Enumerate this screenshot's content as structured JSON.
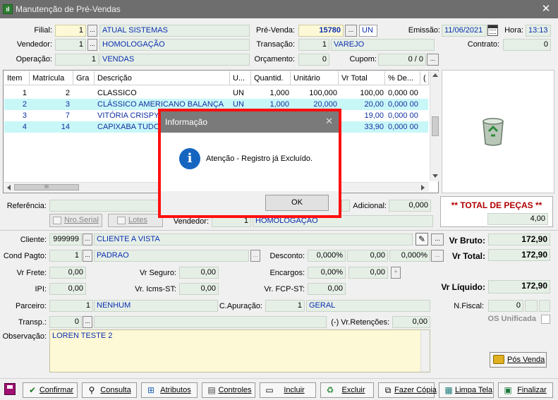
{
  "window": {
    "title": "Manutenção de Pré-Vendas",
    "close": "✕"
  },
  "header": {
    "filial_label": "Filial:",
    "filial_code": "1",
    "filial_name": "ATUAL SISTEMAS",
    "vendedor_label": "Vendedor:",
    "vendedor_code": "1",
    "vendedor_name": "HOMOLOGAÇÃO",
    "operacao_label": "Operação:",
    "operacao_code": "1",
    "operacao_name": "VENDAS",
    "prevenda_label": "Pré-Venda:",
    "prevenda_value": "15780",
    "prevenda_unit": "UN",
    "transacao_label": "Transação:",
    "transacao_code": "1",
    "transacao_name": "VAREJO",
    "orcamento_label": "Orçamento:",
    "orcamento_value": "0",
    "cupom_label": "Cupom:",
    "cupom_value": "0 / 0",
    "emissao_label": "Emissão:",
    "emissao_value": "11/06/2021",
    "hora_label": "Hora:",
    "hora_value": "13:13",
    "contrato_label": "Contrato:",
    "contrato_value": "0",
    "ellipsis": "..."
  },
  "grid": {
    "columns": [
      "Item",
      "Matrícula",
      "Gra",
      "Descrição",
      "U...",
      "Quantid.",
      "Unitário",
      "Vr Total",
      "% De...",
      "("
    ],
    "rows": [
      {
        "item": "1",
        "matricula": "2",
        "gra": "",
        "descricao": "CLASSICO",
        "un": "UN",
        "quantid": "1,000",
        "unitario": "100,000",
        "vrtotal": "100,00",
        "desc": "0,000 00"
      },
      {
        "item": "2",
        "matricula": "3",
        "gra": "",
        "descricao": "CLÁSSICO AMERICANO BALANÇA",
        "un": "UN",
        "quantid": "1,000",
        "unitario": "20,000",
        "vrtotal": "20,00",
        "desc": "0,000 00"
      },
      {
        "item": "3",
        "matricula": "7",
        "gra": "",
        "descricao": "VITÓRIA CRISPY",
        "un": "",
        "quantid": "",
        "unitario": "",
        "vrtotal": "19,00",
        "desc": "0,000 00"
      },
      {
        "item": "4",
        "matricula": "14",
        "gra": "",
        "descricao": "CAPIXABA TUDO",
        "un": "",
        "quantid": "",
        "unitario": "",
        "vrtotal": "33,90",
        "desc": "0,000 00"
      }
    ],
    "hscroll_grip": "III"
  },
  "midbar": {
    "referencia_label": "Referência:",
    "adicional_label": "Adicional:",
    "adicional_value": "0,000",
    "nro_serial": "Nro.Serial",
    "lotes": "Lotes",
    "vendedor_label": "Vendedor:",
    "vendedor_code": "1",
    "vendedor_name": "HOMOLOGAÇÃO"
  },
  "totals": {
    "pecas_label": "** TOTAL DE PEÇAS **",
    "pecas_value": "4,00"
  },
  "footer": {
    "cliente_label": "Cliente:",
    "cliente_code": "999999",
    "cliente_name": "CLIENTE A VISTA",
    "condpagto_label": "Cond Pagto:",
    "condpagto_code": "1",
    "condpagto_name": "PADRAO",
    "desconto_label": "Desconto:",
    "desconto_pct": "0,000%",
    "desconto_val": "0,00",
    "desconto_pct2": "0,000%",
    "vrfrete_label": "Vr Frete:",
    "vrfrete_value": "0,00",
    "vrseguro_label": "Vr Seguro:",
    "vrseguro_value": "0,00",
    "encargos_label": "Encargos:",
    "encargos_pct": "0,00%",
    "encargos_val": "0,00",
    "plus": "+",
    "ipi_label": "IPI:",
    "ipi_value": "0,00",
    "icmsst_label": "Vr. Icms-ST:",
    "icmsst_value": "0,00",
    "fcpst_label": "Vr. FCP-ST:",
    "fcpst_value": "0,00",
    "parceiro_label": "Parceiro:",
    "parceiro_code": "1",
    "parceiro_name": "NENHUM",
    "capuracao_label": "C.Apuração:",
    "capuracao_code": "1",
    "capuracao_name": "GERAL",
    "transp_label": "Transp.:",
    "transp_code": "0",
    "retencoes_label": "(-) Vr.Retenções:",
    "retencoes_value": "0,00",
    "observacao_label": "Observação:",
    "observacao_value": "LOREN TESTE 2",
    "vrbruto_label": "Vr Bruto:",
    "vrbruto_value": "172,90",
    "vrtotal_label": "Vr Total:",
    "vrtotal_value": "172,90",
    "vrliquido_label": "Vr Líquido:",
    "vrliquido_value": "172,90",
    "nfiscal_label": "N.Fiscal:",
    "nfiscal_value": "0",
    "osunificada_label": "OS Unificada",
    "posvenda": "Pós Venda"
  },
  "toolbar": {
    "confirmar": "Confirmar",
    "consulta": "Consulta",
    "atributos": "Atributos",
    "controles": "Controles",
    "incluir": "Incluir",
    "excluir": "Excluir",
    "fazercopia": "Fazer Cópia",
    "limpatela": "Limpa Tela",
    "finalizar": "Finalizar"
  },
  "dialog": {
    "title": "Informação",
    "close": "✕",
    "message": "Atenção - Registro já Excluído.",
    "ok": "OK",
    "icon": "i"
  },
  "colors": {
    "accent_blue": "#0b2fb0",
    "row_cyan": "#c8f7f8",
    "highlight_red": "#ff1010",
    "field_yellow": "#fdf8d6",
    "field_green": "#e6efe6",
    "total_red": "#b00000"
  }
}
